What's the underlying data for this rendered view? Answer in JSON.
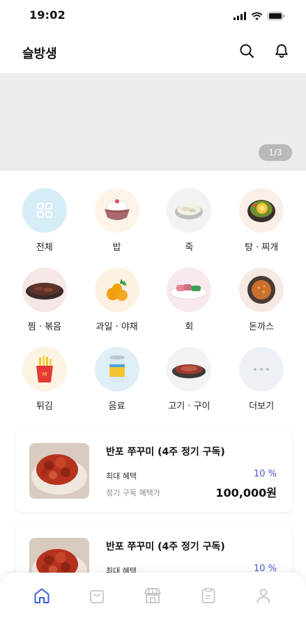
{
  "status_bar": {
    "time": "19:02"
  },
  "header": {
    "title": "슬방생"
  },
  "banner": {
    "pager": "1/3"
  },
  "categories": [
    {
      "label": "전체",
      "icon": "grid-icon"
    },
    {
      "label": "밥",
      "icon": "rice-bowl-icon"
    },
    {
      "label": "죽",
      "icon": "porridge-icon"
    },
    {
      "label": "탕 · 찌개",
      "icon": "stew-pot-icon"
    },
    {
      "label": "찜 · 볶음",
      "icon": "braised-dish-icon"
    },
    {
      "label": "과일 · 야채",
      "icon": "fruit-icon"
    },
    {
      "label": "회",
      "icon": "sashimi-icon"
    },
    {
      "label": "돈까스",
      "icon": "cutlet-icon"
    },
    {
      "label": "튀김",
      "icon": "fries-icon"
    },
    {
      "label": "음료",
      "icon": "drink-can-icon"
    },
    {
      "label": "고기 · 구이",
      "icon": "grilled-meat-icon"
    },
    {
      "label": "더보기",
      "icon": "more-icon"
    }
  ],
  "products": [
    {
      "name": "반포 쭈꾸미 (4주 정기 구독)",
      "benefit_label": "최대 혜택",
      "benefit_value": "10 %",
      "sub_label": "정기 구독  혜택가",
      "price": "100,000원"
    },
    {
      "name": "반포 쭈꾸미 (4주 정기 구독)",
      "benefit_label": "최대 혜택",
      "benefit_value": "10 %",
      "sub_label": "",
      "price": ""
    }
  ],
  "bottom_nav": [
    {
      "icon": "home-icon",
      "active": true
    },
    {
      "icon": "shopping-bag-icon",
      "active": false
    },
    {
      "icon": "store-icon",
      "active": false
    },
    {
      "icon": "order-list-icon",
      "active": false
    },
    {
      "icon": "profile-icon",
      "active": false
    }
  ],
  "colors": {
    "accent": "#3b5bdb",
    "inactive": "#c4c4c4",
    "banner_bg": "#ececec",
    "benefit": "#4c55d6"
  }
}
